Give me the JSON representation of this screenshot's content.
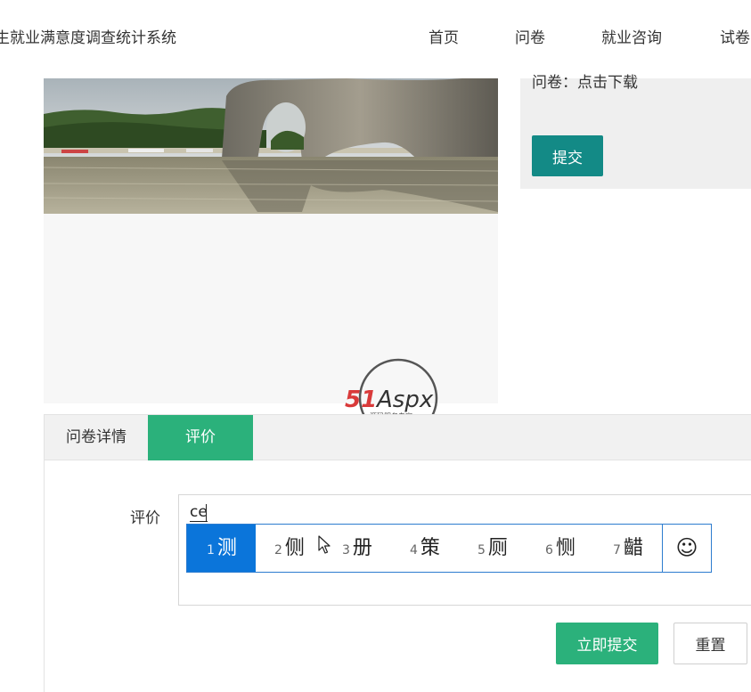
{
  "header": {
    "site_title": "生就业满意度调查统计系统",
    "nav": [
      {
        "label": "首页"
      },
      {
        "label": "问卷"
      },
      {
        "label": "就业咨询"
      },
      {
        "label": "试卷"
      }
    ]
  },
  "right_panel": {
    "questionnaire_line": "问卷：点击下载",
    "submit_label": "提交"
  },
  "watermark": {
    "brand": "51Aspx",
    "slogan": "源码服务专家"
  },
  "tabs": [
    {
      "label": "问卷详情",
      "active": false
    },
    {
      "label": "评价",
      "active": true
    }
  ],
  "form": {
    "review_label": "评价",
    "review_value": "ce",
    "submit_label": "立即提交",
    "reset_label": "重置"
  },
  "ime": {
    "candidates": [
      {
        "num": "1",
        "text": "测"
      },
      {
        "num": "2",
        "text": "侧"
      },
      {
        "num": "3",
        "text": "册"
      },
      {
        "num": "4",
        "text": "策"
      },
      {
        "num": "5",
        "text": "厕"
      },
      {
        "num": "6",
        "text": "恻"
      },
      {
        "num": "7",
        "text": "齰"
      }
    ],
    "emoji_icon": "☺"
  },
  "colors": {
    "accent_green": "#2bb17b",
    "teal": "#138a86",
    "ime_blue": "#0b75da"
  }
}
